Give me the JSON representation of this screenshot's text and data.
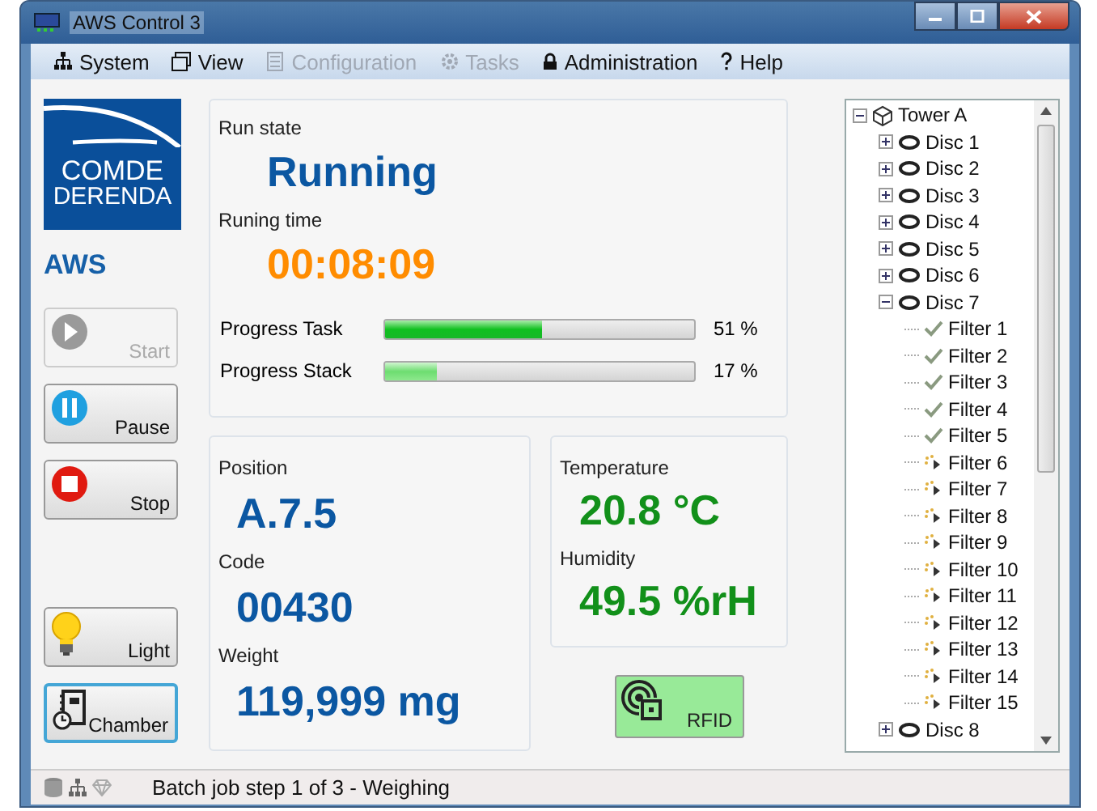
{
  "window": {
    "title": "AWS Control 3"
  },
  "menu": [
    {
      "label": "System",
      "disabled": false
    },
    {
      "label": "View",
      "disabled": false
    },
    {
      "label": "Configuration",
      "disabled": true
    },
    {
      "label": "Tasks",
      "disabled": true
    },
    {
      "label": "Administration",
      "disabled": false
    },
    {
      "label": "Help",
      "disabled": false
    }
  ],
  "logo": {
    "line_1": "COMDE",
    "line_2": "DERENDA"
  },
  "app_name": "AWS",
  "controls": [
    {
      "label": "Start",
      "disabled": true,
      "focused": false
    },
    {
      "label": "Pause",
      "disabled": false,
      "focused": false
    },
    {
      "label": "Stop",
      "disabled": false,
      "focused": false
    }
  ],
  "extra_buttons": [
    {
      "label": "Light",
      "disabled": false,
      "focused": false
    },
    {
      "label": "Chamber",
      "disabled": false,
      "focused": true
    }
  ],
  "run_state": {
    "label": "Run state",
    "value": "Running"
  },
  "running_time": {
    "label": "Runing time",
    "value": "00:08:09"
  },
  "progress": [
    {
      "label": "Progress Task",
      "level": 0.51,
      "reading": "51 %"
    },
    {
      "label": "Progress Stack",
      "level": 0.17,
      "reading": "17 %"
    }
  ],
  "sample": [
    {
      "label": "Position",
      "value": "A.7.5"
    },
    {
      "label": "Code",
      "value": "00430"
    },
    {
      "label": "Weight",
      "value": "119,999 mg"
    }
  ],
  "climate": [
    {
      "label": "Temperature",
      "value": "20.8 °C"
    },
    {
      "label": "Humidity",
      "value": "49.5 %rH"
    }
  ],
  "rfid": {
    "label": "RFID",
    "active": true
  },
  "tree": {
    "label": "Tower A",
    "expanded": true,
    "children": [
      {
        "label": "Disc 1",
        "expanded": false
      },
      {
        "label": "Disc 2",
        "expanded": false
      },
      {
        "label": "Disc 3",
        "expanded": false
      },
      {
        "label": "Disc 4",
        "expanded": false
      },
      {
        "label": "Disc 5",
        "expanded": false
      },
      {
        "label": "Disc 6",
        "expanded": false
      },
      {
        "label": "Disc 7",
        "expanded": true,
        "children": [
          {
            "label": "Filter 1",
            "kind": "done"
          },
          {
            "label": "Filter 2",
            "kind": "done"
          },
          {
            "label": "Filter 3",
            "kind": "done"
          },
          {
            "label": "Filter 4",
            "kind": "done"
          },
          {
            "label": "Filter 5",
            "kind": "done"
          },
          {
            "label": "Filter 6",
            "kind": "pending"
          },
          {
            "label": "Filter 7",
            "kind": "pending"
          },
          {
            "label": "Filter 8",
            "kind": "pending"
          },
          {
            "label": "Filter 9",
            "kind": "pending"
          },
          {
            "label": "Filter 10",
            "kind": "pending"
          },
          {
            "label": "Filter 11",
            "kind": "pending"
          },
          {
            "label": "Filter 12",
            "kind": "pending"
          },
          {
            "label": "Filter 13",
            "kind": "pending"
          },
          {
            "label": "Filter 14",
            "kind": "pending"
          },
          {
            "label": "Filter 15",
            "kind": "pending"
          }
        ]
      },
      {
        "label": "Disc 8",
        "expanded": false
      }
    ]
  },
  "status_bar": {
    "text": "Batch job step 1 of 3 - Weighing"
  }
}
